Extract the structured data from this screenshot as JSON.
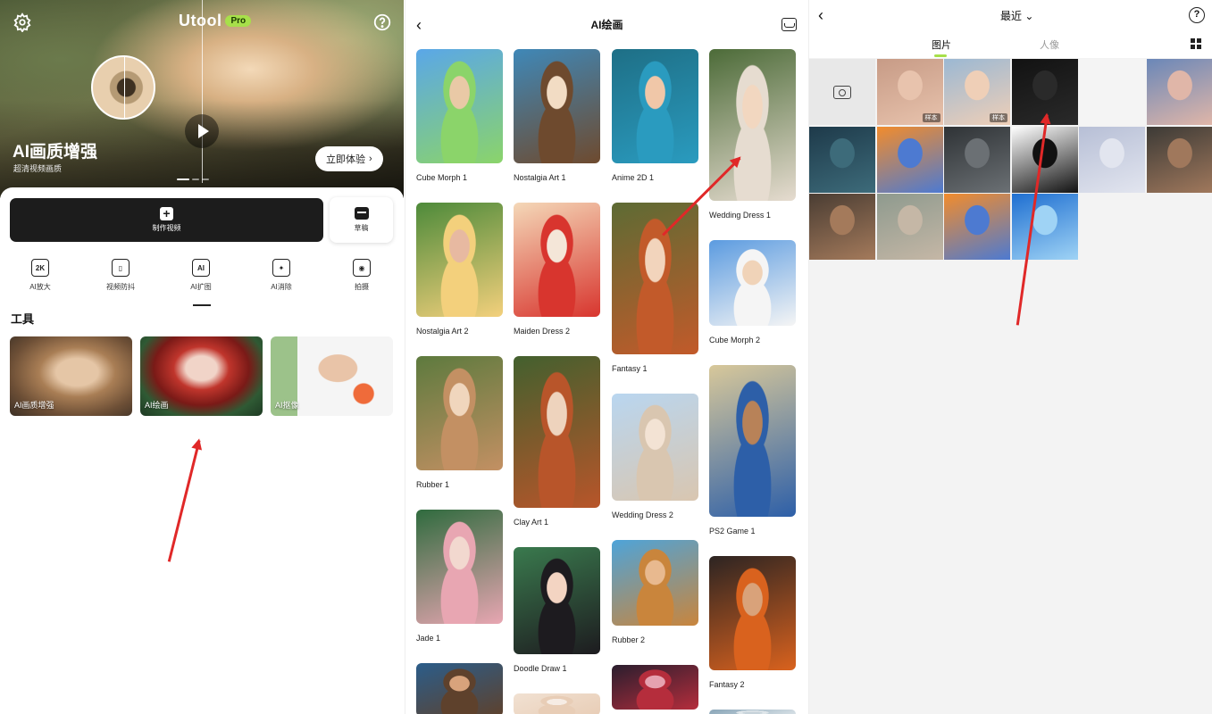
{
  "home": {
    "brand": "Utool",
    "pro_badge": "Pro",
    "settings_icon": "gear-icon",
    "help_icon": "question-circle-icon",
    "hero_title": "AI画质增强",
    "hero_subtitle": "超清视频画质",
    "hero_button": "立即体验",
    "make_video_label": "制作视频",
    "drafts_label": "草稿",
    "quick_actions": [
      {
        "label": "AI放大",
        "icon": "2k-upscale-icon",
        "glyph": "2K"
      },
      {
        "label": "视频防抖",
        "icon": "stabilize-icon",
        "glyph": "▯"
      },
      {
        "label": "AI扩图",
        "icon": "expand-image-icon",
        "glyph": "AI"
      },
      {
        "label": "AI消除",
        "icon": "magic-wand-icon",
        "glyph": "✦"
      },
      {
        "label": "拍摄",
        "icon": "camera-icon",
        "glyph": "◉"
      }
    ],
    "tools_heading": "工具",
    "tools": [
      {
        "label": "AI画质增强"
      },
      {
        "label": "AI绘画"
      },
      {
        "label": "AI抠像"
      }
    ]
  },
  "gallery": {
    "title": "AI绘画",
    "back_icon": "back-arrow-icon",
    "inbox_icon": "inbox-icon",
    "columns": [
      [
        {
          "label": "Cube Morph 1",
          "colors": [
            "#5aa7e8",
            "#8bd46a",
            "#e9c9a6"
          ]
        },
        {
          "label": "Nostalgia Art 2",
          "colors": [
            "#4d8a3a",
            "#f3d07c",
            "#e7b9a1"
          ]
        },
        {
          "label": "Rubber 1",
          "colors": [
            "#5d7a3e",
            "#c39063",
            "#f0d6bd"
          ]
        },
        {
          "label": "Jade 1",
          "colors": [
            "#2f6b3e",
            "#e8a6b2",
            "#f2d8cf"
          ]
        },
        {
          "label": "",
          "colors": [
            "#2b5d8a",
            "#5e412c",
            "#d8a37c"
          ]
        }
      ],
      [
        {
          "label": "Nostalgia Art 1",
          "colors": [
            "#3f88b8",
            "#6e4a2e",
            "#f2dcc4"
          ]
        },
        {
          "label": "Maiden Dress 2",
          "colors": [
            "#f4d8b8",
            "#d8352e",
            "#f4e6d8"
          ]
        },
        {
          "label": "Clay Art 1",
          "colors": [
            "#43602e",
            "#b8552a",
            "#eed3bd"
          ]
        },
        {
          "label": "Doodle Draw 1",
          "colors": [
            "#3a7a4e",
            "#1d1b1f",
            "#f3d4c2"
          ]
        },
        {
          "label": "",
          "colors": [
            "#f1e1d2",
            "#e8cdb6",
            "#f6ece4"
          ]
        }
      ],
      [
        {
          "label": "Anime 2D 1",
          "colors": [
            "#1e6f86",
            "#2a9bbf",
            "#f0c7a8"
          ]
        },
        {
          "label": "Fantasy 1",
          "colors": [
            "#5d6b34",
            "#c25a2a",
            "#f2d4bc"
          ]
        },
        {
          "label": "Wedding Dress 2",
          "colors": [
            "#b9d6f0",
            "#d9c6b0",
            "#f3e3d4"
          ]
        },
        {
          "label": "Rubber 2",
          "colors": [
            "#4ea4d9",
            "#c9853c",
            "#e8b98f"
          ]
        },
        {
          "label": "",
          "colors": [
            "#2a1e2e",
            "#b52d3c",
            "#e6a2b0"
          ]
        }
      ],
      [
        {
          "label": "Wedding Dress 1",
          "colors": [
            "#4c6b38",
            "#e6dcd0",
            "#f2d7c0"
          ]
        },
        {
          "label": "Cube Morph 2",
          "colors": [
            "#5b9be0",
            "#f5f5f5",
            "#f0d3b8"
          ]
        },
        {
          "label": "PS2 Game 1",
          "colors": [
            "#d8c89a",
            "#2d5fa8",
            "#b88258"
          ]
        },
        {
          "label": "Fantasy 2",
          "colors": [
            "#2c2422",
            "#d9621e",
            "#d9a27a"
          ]
        },
        {
          "label": "",
          "colors": [
            "#8aa6b8",
            "#dfe6ea",
            "#c7d3da"
          ]
        }
      ]
    ]
  },
  "picker": {
    "back_icon": "back-arrow-icon",
    "album_label": "最近",
    "help_icon": "question-circle-icon",
    "tabs": [
      {
        "label": "图片"
      },
      {
        "label": "人像"
      }
    ],
    "grid_icon": "grid-view-icon",
    "camera_icon": "camera-icon",
    "sample_tag": "样本",
    "cells": [
      {
        "colors": [
          "#c79b86",
          "#e8c3ad"
        ],
        "tag": true
      },
      {
        "colors": [
          "#9bb8d3",
          "#efcfb7"
        ],
        "tag": true
      },
      {
        "colors": [
          "#121212",
          "#2a2a2a"
        ],
        "tag": false
      },
      {
        "colors": [
          "#f4f4f4",
          "#f4f4f4"
        ],
        "tag": false
      },
      {
        "colors": [
          "#6a87b8",
          "#e0b6a8"
        ],
        "tag": false
      },
      {
        "colors": [
          "#1e3a4a",
          "#3d6b7a"
        ],
        "tag": false
      },
      {
        "colors": [
          "#f28c2c",
          "#4d7ad1"
        ],
        "tag": false
      },
      {
        "colors": [
          "#2f3336",
          "#6b7074"
        ],
        "tag": false
      },
      {
        "colors": [
          "#ffffff",
          "#111111"
        ],
        "tag": false
      },
      {
        "colors": [
          "#b7bfd6",
          "#e2e5ef"
        ],
        "tag": false
      },
      {
        "colors": [
          "#3c3a36",
          "#a0785c"
        ],
        "tag": false
      },
      {
        "colors": [
          "#4a3d33",
          "#a47a5b"
        ],
        "tag": false
      },
      {
        "colors": [
          "#8e9a8e",
          "#c5b7a6"
        ],
        "tag": false
      },
      {
        "colors": [
          "#f28c2c",
          "#4d7ad1"
        ],
        "tag": false
      },
      {
        "colors": [
          "#1f6fd1",
          "#9fd3f5"
        ],
        "tag": false
      }
    ]
  }
}
